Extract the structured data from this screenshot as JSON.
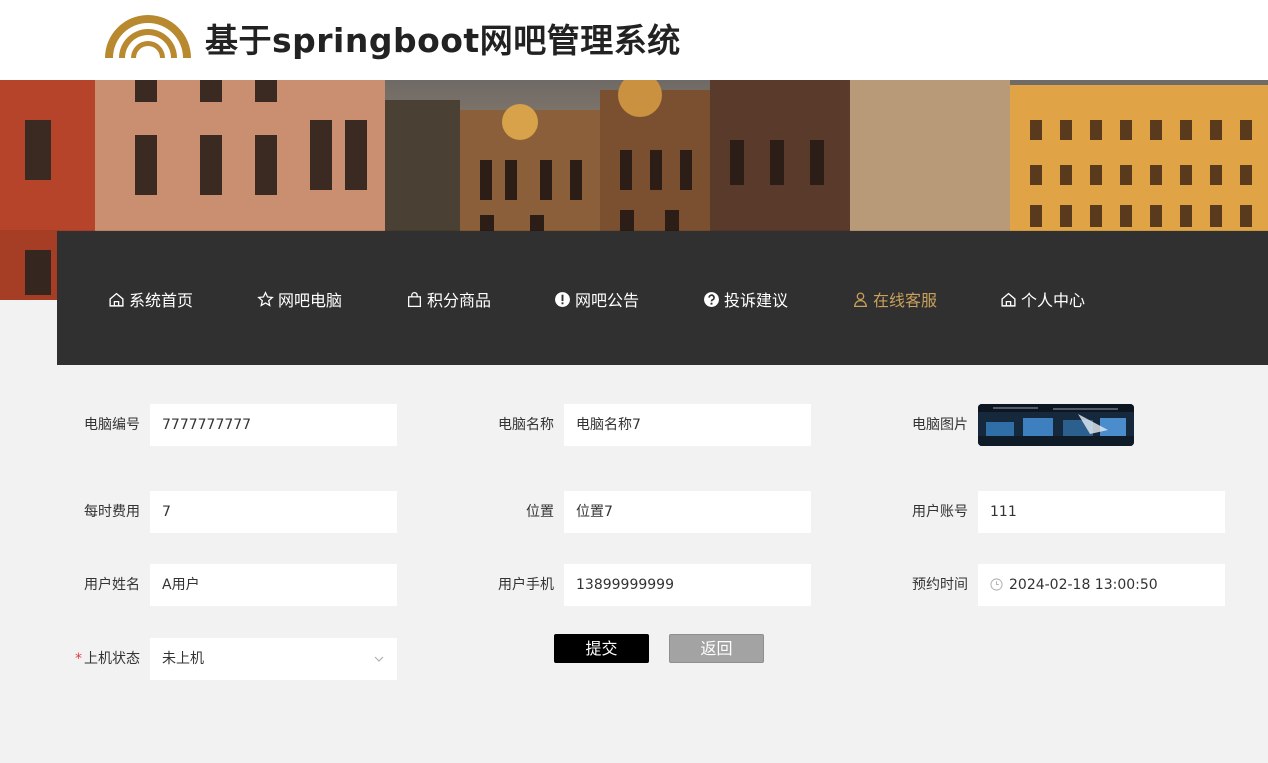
{
  "header": {
    "site_title": "基于springboot网吧管理系统",
    "accent_color": "#b8892f"
  },
  "nav": {
    "items": [
      {
        "label": "系统首页",
        "icon": "home-icon"
      },
      {
        "label": "网吧电脑",
        "icon": "star-icon"
      },
      {
        "label": "积分商品",
        "icon": "shopping-bag-icon"
      },
      {
        "label": "网吧公告",
        "icon": "info-circle-icon"
      },
      {
        "label": "投诉建议",
        "icon": "question-circle-icon"
      },
      {
        "label": "在线客服",
        "icon": "user-icon",
        "active": true
      },
      {
        "label": "个人中心",
        "icon": "home-icon"
      }
    ],
    "active_color": "#c9a05b",
    "background": "#303030"
  },
  "form": {
    "computer_no": {
      "label": "电脑编号",
      "value": "7777777777"
    },
    "computer_name": {
      "label": "电脑名称",
      "value": "电脑名称7"
    },
    "computer_image": {
      "label": "电脑图片"
    },
    "hourly_fee": {
      "label": "每时费用",
      "value": "7"
    },
    "location": {
      "label": "位置",
      "value": "位置7"
    },
    "user_account": {
      "label": "用户账号",
      "value": "111"
    },
    "user_name": {
      "label": "用户姓名",
      "value": "A用户"
    },
    "user_phone": {
      "label": "用户手机",
      "value": "13899999999"
    },
    "reserve_time": {
      "label": "预约时间",
      "value": "2024-02-18 13:00:50"
    },
    "status": {
      "label": "上机状态",
      "value": "未上机",
      "required_mark": "*"
    }
  },
  "buttons": {
    "submit": "提交",
    "back": "返回"
  }
}
